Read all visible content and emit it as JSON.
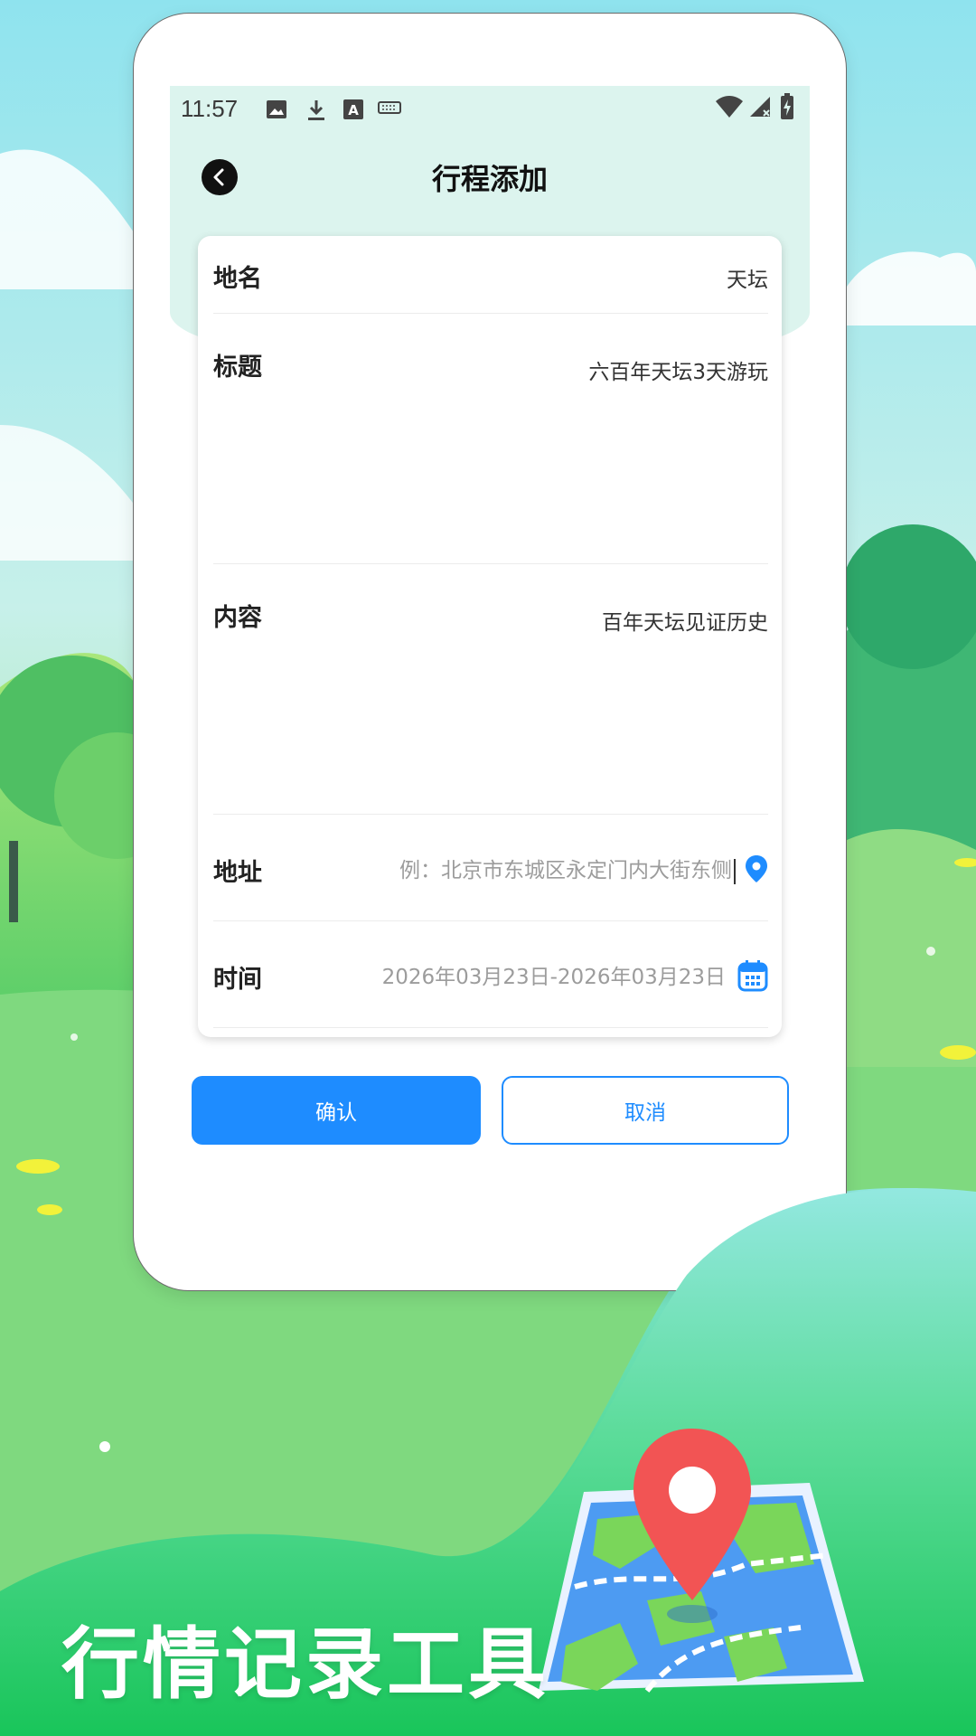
{
  "status_bar": {
    "time": "11:57"
  },
  "header": {
    "title": "行程添加"
  },
  "form": {
    "place": {
      "label": "地名",
      "value": "天坛"
    },
    "title": {
      "label": "标题",
      "value": "六百年天坛3天游玩"
    },
    "content": {
      "label": "内容",
      "value": "百年天坛见证历史"
    },
    "address": {
      "label": "地址",
      "placeholder": "例：北京市东城区永定门内大街东侧"
    },
    "time": {
      "label": "时间",
      "value": "2026年03月23日-2026年03月23日"
    }
  },
  "buttons": {
    "confirm": "确认",
    "cancel": "取消"
  },
  "promo": {
    "slogan": "行情记录工具"
  },
  "colors": {
    "accent": "#1e8cff",
    "header_bg": "#dcf4ee",
    "pin_red": "#f25454"
  }
}
